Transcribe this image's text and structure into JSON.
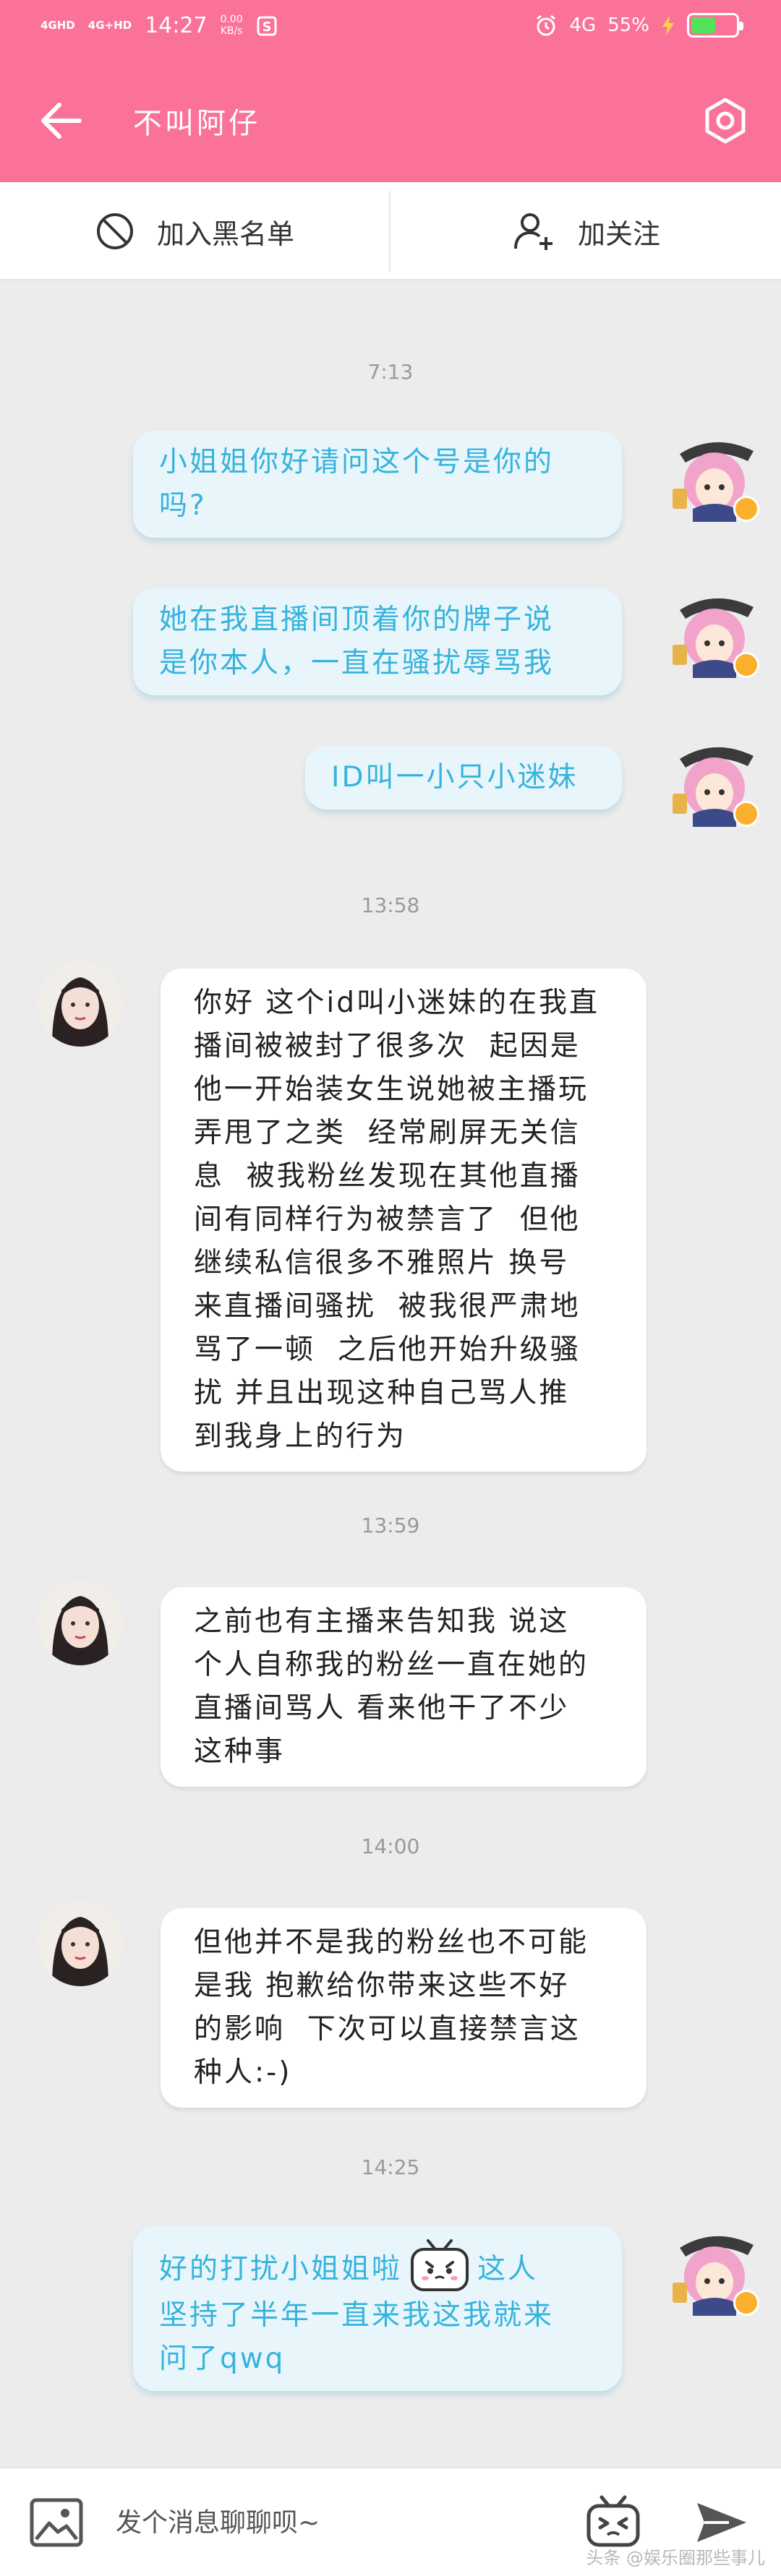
{
  "status_bar": {
    "network_1": "4GHD",
    "network_2": "4G+HD",
    "time": "14:27",
    "speed_value": "0.00",
    "speed_unit": "KB/s",
    "mobile_data": "4G",
    "battery": "55%",
    "battery_level": 0.55
  },
  "header": {
    "title": "不叫阿仔"
  },
  "actions": {
    "block_label": "加入黑名单",
    "follow_label": "加关注"
  },
  "messages": [
    {
      "time": "7:13"
    },
    {
      "sender": "me",
      "text": "小姐姐你好请问这个号是你的\n吗?"
    },
    {
      "sender": "me",
      "text": "她在我直播间顶着你的牌子说\n是你本人，一直在骚扰辱骂我"
    },
    {
      "sender": "me",
      "text": "ID叫一小只小迷妹"
    },
    {
      "time": "13:58"
    },
    {
      "sender": "them",
      "text": "你好 这个id叫小迷妹的在我直\n播间被被封了很多次  起因是\n他一开始装女生说她被主播玩\n弄甩了之类  经常刷屏无关信\n息  被我粉丝发现在其他直播\n间有同样行为被禁言了  但他\n继续私信很多不雅照片 换号\n来直播间骚扰  被我很严肃地\n骂了一顿  之后他开始升级骚\n扰 并且出现这种自己骂人推\n到我身上的行为"
    },
    {
      "time": "13:59"
    },
    {
      "sender": "them",
      "text": "之前也有主播来告知我 说这\n个人自称我的粉丝一直在她的\n直播间骂人 看来他干了不少\n这种事"
    },
    {
      "time": "14:00"
    },
    {
      "sender": "them",
      "text": "但他并不是我的粉丝也不可能\n是我 抱歉给你带来这些不好\n的影响  下次可以直接禁言这\n种人:-)"
    },
    {
      "time": "14:25"
    },
    {
      "sender": "me",
      "text_before": "好的打扰小姐姐啦",
      "text_after": "这人\n坚持了半年一直来我这我就来\n问了qwq"
    }
  ],
  "input": {
    "placeholder": "发个消息聊聊呗~"
  },
  "watermark": "头条 @娱乐圈那些事儿",
  "colors": {
    "brand": "#fb7299",
    "outgoing_text": "#36b3dc",
    "outgoing_bg": "#e8f6fc"
  },
  "icons": {
    "back": "arrow-left-icon",
    "settings": "gear-icon",
    "block": "prohibit-icon",
    "follow": "add-user-icon",
    "image": "image-icon",
    "emoji": "bilibili-tv-emoji-icon",
    "send": "send-icon"
  }
}
